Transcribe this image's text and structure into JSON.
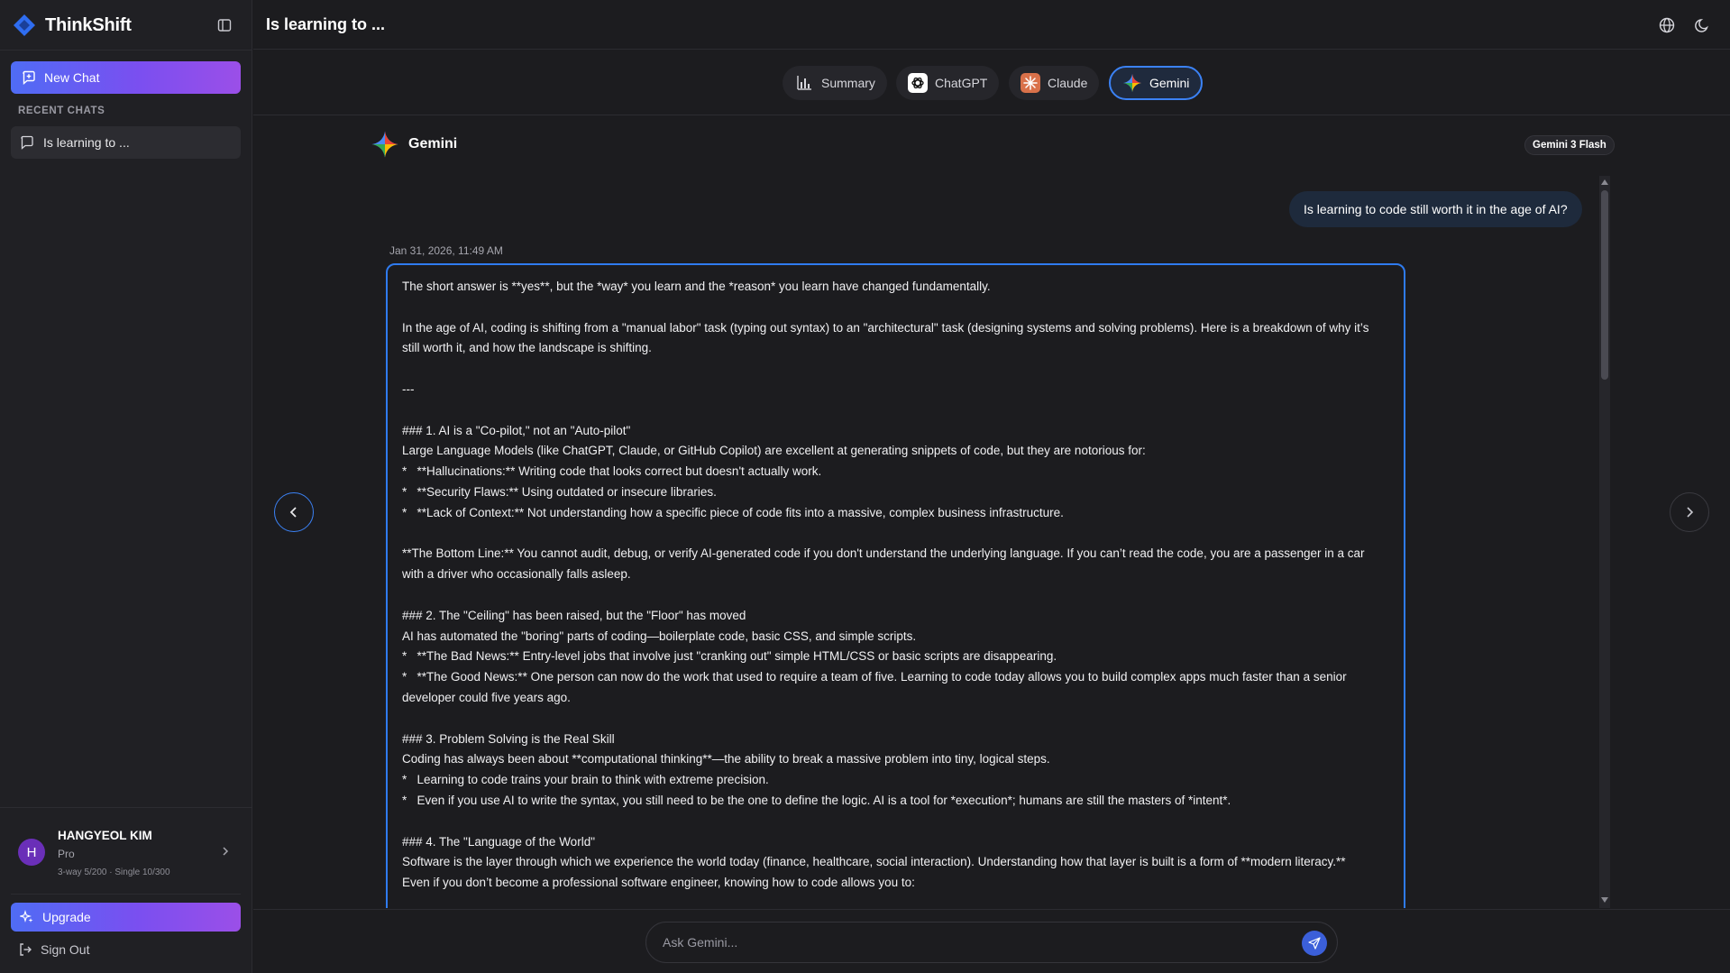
{
  "app": {
    "name": "ThinkShift"
  },
  "sidebar": {
    "new_chat_label": "New Chat",
    "recent_label": "RECENT CHATS",
    "recent_items": [
      {
        "label": "Is learning to ..."
      }
    ],
    "user": {
      "initial": "H",
      "name": "HANGYEOL KIM",
      "plan": "Pro",
      "quota": "3-way 5/200 · Single 10/300"
    },
    "upgrade_label": "Upgrade",
    "signout_label": "Sign Out"
  },
  "header": {
    "title": "Is learning to ..."
  },
  "tabs": [
    {
      "label": "Summary",
      "icon": "bar-chart-icon",
      "active": false
    },
    {
      "label": "ChatGPT",
      "icon": "openai-icon",
      "active": false
    },
    {
      "label": "Claude",
      "icon": "claude-icon",
      "active": false
    },
    {
      "label": "Gemini",
      "icon": "gemini-icon",
      "active": true
    }
  ],
  "model": {
    "name": "Gemini",
    "badge": "Gemini 3 Flash"
  },
  "chat": {
    "user_message": "Is learning to code still worth it in the age of AI?",
    "timestamp": "Jan 31, 2026, 11:49 AM",
    "response_lines": [
      "The short answer is **yes**, but the *way* you learn and the *reason* you learn have changed fundamentally.",
      "",
      "In the age of AI, coding is shifting from a \"manual labor\" task (typing out syntax) to an \"architectural\" task (designing systems and solving problems). Here is a breakdown of why it’s still worth it, and how the landscape is shifting.",
      "",
      "---",
      "",
      "### 1. AI is a \"Co-pilot,\" not an \"Auto-pilot\"",
      "Large Language Models (like ChatGPT, Claude, or GitHub Copilot) are excellent at generating snippets of code, but they are notorious for:",
      "*   **Hallucinations:** Writing code that looks correct but doesn't actually work.",
      "*   **Security Flaws:** Using outdated or insecure libraries.",
      "*   **Lack of Context:** Not understanding how a specific piece of code fits into a massive, complex business infrastructure.",
      "",
      "**The Bottom Line:** You cannot audit, debug, or verify AI-generated code if you don't understand the underlying language. If you can’t read the code, you are a passenger in a car with a driver who occasionally falls asleep.",
      "",
      "### 2. The \"Ceiling\" has been raised, but the \"Floor\" has moved",
      "AI has automated the \"boring\" parts of coding—boilerplate code, basic CSS, and simple scripts.",
      "*   **The Bad News:** Entry-level jobs that involve just \"cranking out\" simple HTML/CSS or basic scripts are disappearing.",
      "*   **The Good News:** One person can now do the work that used to require a team of five. Learning to code today allows you to build complex apps much faster than a senior developer could five years ago.",
      "",
      "### 3. Problem Solving is the Real Skill",
      "Coding has always been about **computational thinking**—the ability to break a massive problem into tiny, logical steps.",
      "*   Learning to code trains your brain to think with extreme precision.",
      "*   Even if you use AI to write the syntax, you still need to be the one to define the logic. AI is a tool for *execution*; humans are still the masters of *intent*.",
      "",
      "### 4. The \"Language of the World\"",
      "Software is the layer through which we experience the world today (finance, healthcare, social interaction). Understanding how that layer is built is a form of **modern literacy.**",
      "Even if you don’t become a professional software engineer, knowing how to code allows you to:"
    ]
  },
  "input": {
    "placeholder": "Ask Gemini..."
  },
  "colors": {
    "accent": "#3b82f6",
    "gradient_start": "#4f6cf5",
    "gradient_end": "#9b4fe8"
  }
}
